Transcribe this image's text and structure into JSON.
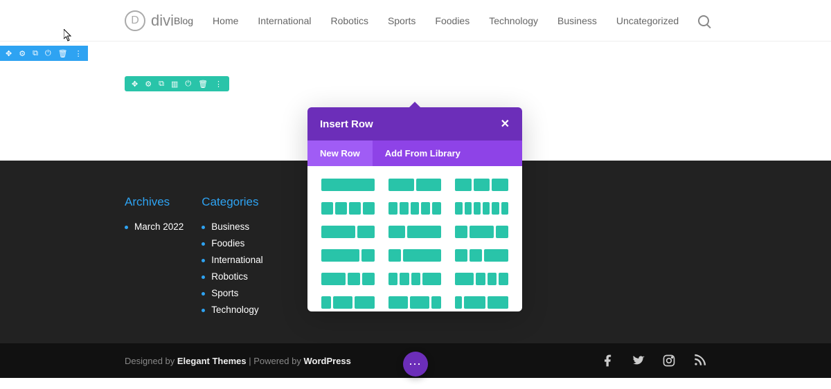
{
  "header": {
    "logo_text": "divi",
    "nav": [
      "Blog",
      "Home",
      "International",
      "Robotics",
      "Sports",
      "Foodies",
      "Technology",
      "Business",
      "Uncategorized"
    ]
  },
  "footer": {
    "archives_title": "Archives",
    "archives_items": [
      "March 2022"
    ],
    "categories_title": "Categories",
    "categories_items": [
      "Business",
      "Foodies",
      "International",
      "Robotics",
      "Sports",
      "Technology"
    ],
    "credit_prefix": "Designed by ",
    "credit_theme": "Elegant Themes",
    "credit_mid": " | Powered by ",
    "credit_platform": "WordPress"
  },
  "modal": {
    "title": "Insert Row",
    "tab_new": "New Row",
    "tab_library": "Add From Library",
    "layouts": [
      [
        1
      ],
      [
        1,
        1
      ],
      [
        1,
        1,
        1
      ],
      [
        1,
        1,
        1,
        1
      ],
      [
        1,
        1,
        1,
        1,
        1
      ],
      [
        1,
        1,
        1,
        1,
        1,
        1
      ],
      [
        2,
        1
      ],
      [
        1,
        2
      ],
      [
        1,
        2,
        1
      ],
      [
        3,
        1
      ],
      [
        1,
        3
      ],
      [
        1,
        1,
        2
      ],
      [
        2,
        1,
        1
      ],
      [
        1,
        1,
        1,
        2
      ],
      [
        2,
        1,
        1,
        1
      ],
      [
        1,
        2,
        2
      ],
      [
        2,
        2,
        1
      ],
      [
        1,
        3,
        3
      ]
    ]
  },
  "icons": {
    "section_toolbar": [
      "move-icon",
      "gear-icon",
      "duplicate-icon",
      "power-icon",
      "trash-icon",
      "more-icon"
    ],
    "row_toolbar": [
      "move-icon",
      "gear-icon",
      "duplicate-icon",
      "columns-icon",
      "power-icon",
      "trash-icon",
      "more-icon"
    ]
  },
  "colors": {
    "blue": "#2ea3f2",
    "teal": "#29c4a9",
    "purpleDark": "#6c2eb9",
    "purple": "#8e43e7"
  }
}
